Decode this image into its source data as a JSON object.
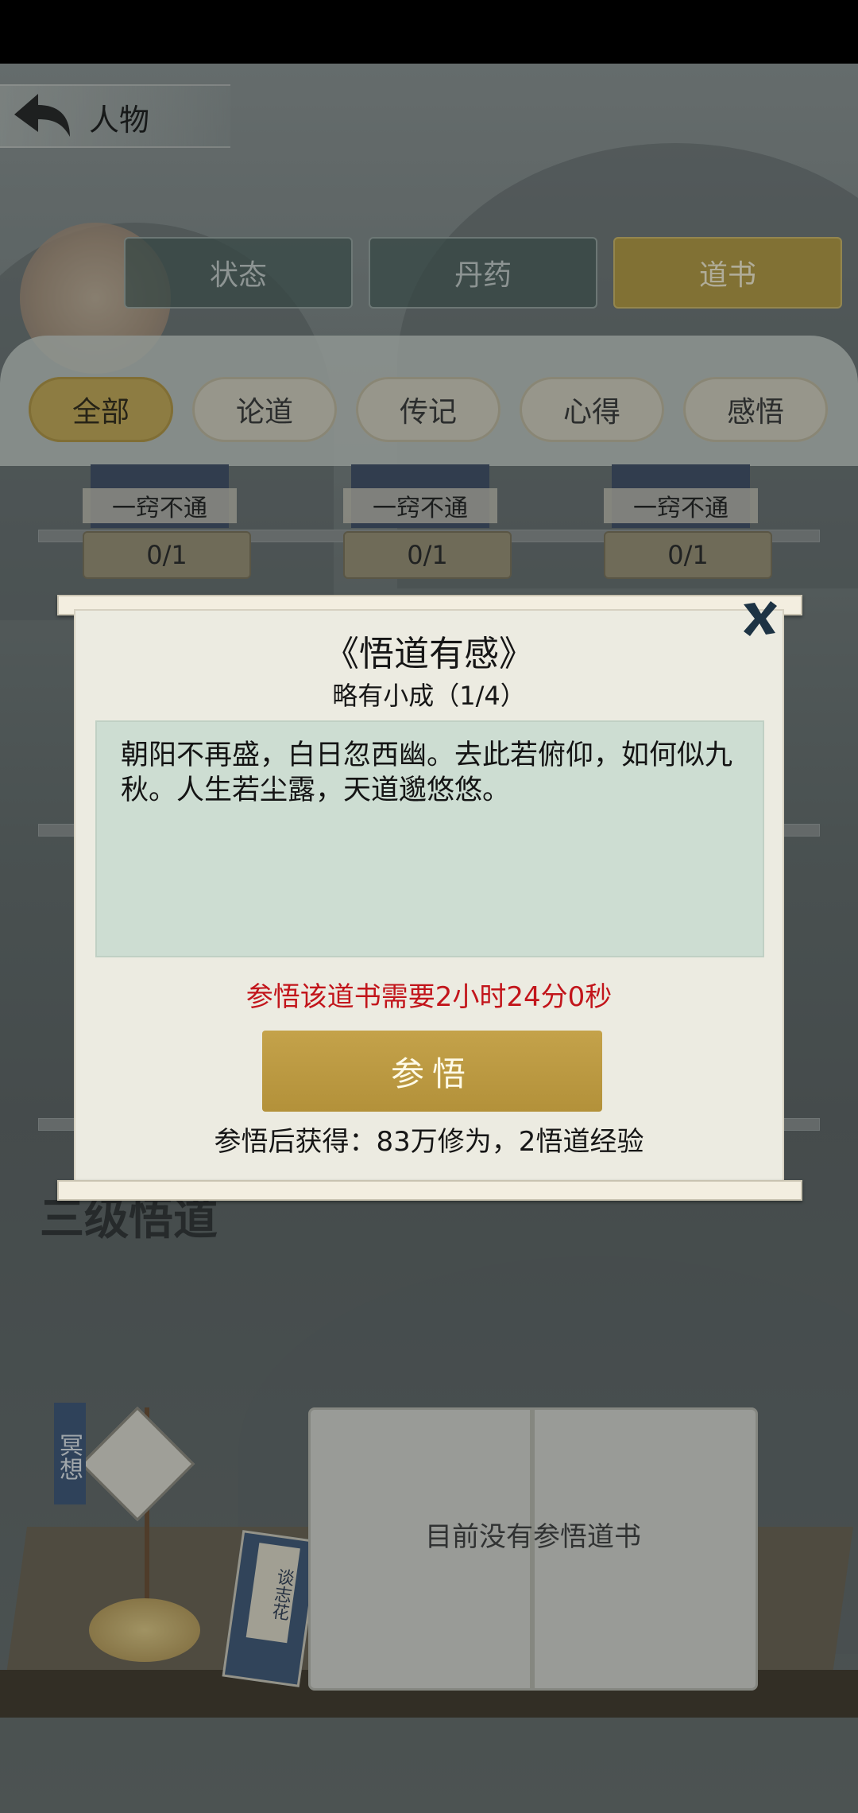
{
  "header": {
    "title": "人物"
  },
  "tabs": [
    {
      "label": "状态",
      "active": false
    },
    {
      "label": "丹药",
      "active": false
    },
    {
      "label": "道书",
      "active": true
    }
  ],
  "filters": [
    {
      "label": "全部",
      "active": true
    },
    {
      "label": "论道",
      "active": false
    },
    {
      "label": "传记",
      "active": false
    },
    {
      "label": "心得",
      "active": false
    },
    {
      "label": "感悟",
      "active": false
    }
  ],
  "books": [
    {
      "title": "一窍不通",
      "count": "0/1"
    },
    {
      "title": "一窍不通",
      "count": "0/1"
    },
    {
      "title": "一窍不通",
      "count": "0/1"
    }
  ],
  "level_title": "三级悟道",
  "study": {
    "empty_message": "目前没有参悟道书",
    "meditate_label": "冥想",
    "closed_book_label": "谈志花"
  },
  "modal": {
    "title": "《悟道有感》",
    "subtitle": "略有小成（1/4）",
    "poem": "朝阳不再盛，白日忽西幽。去此若俯仰，如何似九秋。人生若尘露，天道邈悠悠。",
    "requirement": "参悟该道书需要2小时24分0秒",
    "button_label": "参悟",
    "reward": "参悟后获得：83万修为，2悟道经验"
  },
  "colors": {
    "accent_gold": "#b79c3e",
    "warning_red": "#c2151b",
    "poem_bg": "#cdddd2"
  }
}
